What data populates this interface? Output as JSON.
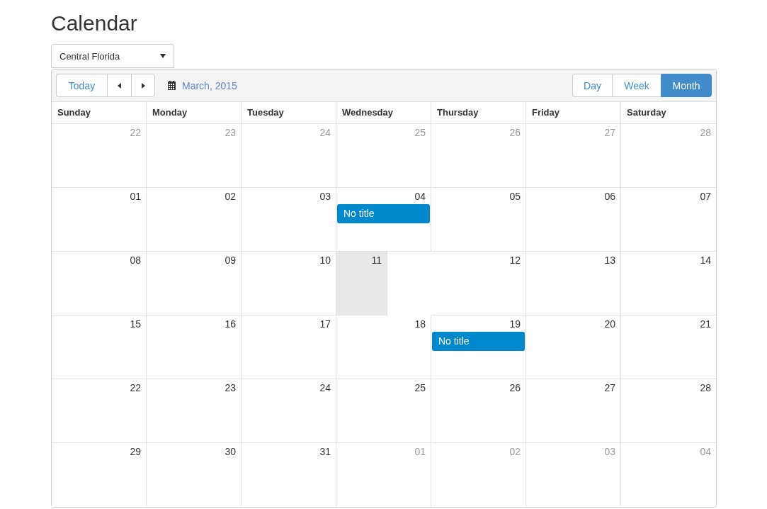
{
  "page": {
    "title": "Calendar"
  },
  "region_select": {
    "value": "Central Florida"
  },
  "toolbar": {
    "today": "Today",
    "period": "March, 2015",
    "views": [
      {
        "label": "Day",
        "selected": false
      },
      {
        "label": "Week",
        "selected": false
      },
      {
        "label": "Month",
        "selected": true
      }
    ]
  },
  "calendar": {
    "weekdays": [
      "Sunday",
      "Monday",
      "Tuesday",
      "Wednesday",
      "Thursday",
      "Friday",
      "Saturday"
    ],
    "weeks": [
      [
        {
          "day": "22",
          "muted": true,
          "today": false
        },
        {
          "day": "23",
          "muted": true,
          "today": false
        },
        {
          "day": "24",
          "muted": true,
          "today": false
        },
        {
          "day": "25",
          "muted": true,
          "today": false
        },
        {
          "day": "26",
          "muted": true,
          "today": false
        },
        {
          "day": "27",
          "muted": true,
          "today": false
        },
        {
          "day": "28",
          "muted": true,
          "today": false
        }
      ],
      [
        {
          "day": "01",
          "muted": false,
          "today": false
        },
        {
          "day": "02",
          "muted": false,
          "today": false
        },
        {
          "day": "03",
          "muted": false,
          "today": false
        },
        {
          "day": "04",
          "muted": false,
          "today": false,
          "events": [
            {
              "title": "No title"
            }
          ]
        },
        {
          "day": "05",
          "muted": false,
          "today": false
        },
        {
          "day": "06",
          "muted": false,
          "today": false
        },
        {
          "day": "07",
          "muted": false,
          "today": false
        }
      ],
      [
        {
          "day": "08",
          "muted": false,
          "today": false
        },
        {
          "day": "09",
          "muted": false,
          "today": false
        },
        {
          "day": "10",
          "muted": false,
          "today": false
        },
        {
          "day": "11",
          "muted": false,
          "today": true
        },
        {
          "day": "12",
          "muted": false,
          "today": false
        },
        {
          "day": "13",
          "muted": false,
          "today": false
        },
        {
          "day": "14",
          "muted": false,
          "today": false
        }
      ],
      [
        {
          "day": "15",
          "muted": false,
          "today": false
        },
        {
          "day": "16",
          "muted": false,
          "today": false
        },
        {
          "day": "17",
          "muted": false,
          "today": false
        },
        {
          "day": "18",
          "muted": false,
          "today": false
        },
        {
          "day": "19",
          "muted": false,
          "today": false,
          "events": [
            {
              "title": "No title"
            }
          ]
        },
        {
          "day": "20",
          "muted": false,
          "today": false
        },
        {
          "day": "21",
          "muted": false,
          "today": false
        }
      ],
      [
        {
          "day": "22",
          "muted": false,
          "today": false
        },
        {
          "day": "23",
          "muted": false,
          "today": false
        },
        {
          "day": "24",
          "muted": false,
          "today": false
        },
        {
          "day": "25",
          "muted": false,
          "today": false
        },
        {
          "day": "26",
          "muted": false,
          "today": false
        },
        {
          "day": "27",
          "muted": false,
          "today": false
        },
        {
          "day": "28",
          "muted": false,
          "today": false
        }
      ],
      [
        {
          "day": "29",
          "muted": false,
          "today": false
        },
        {
          "day": "30",
          "muted": false,
          "today": false
        },
        {
          "day": "31",
          "muted": false,
          "today": false
        },
        {
          "day": "01",
          "muted": true,
          "today": false
        },
        {
          "day": "02",
          "muted": true,
          "today": false
        },
        {
          "day": "03",
          "muted": true,
          "today": false
        },
        {
          "day": "04",
          "muted": true,
          "today": false
        }
      ]
    ]
  }
}
